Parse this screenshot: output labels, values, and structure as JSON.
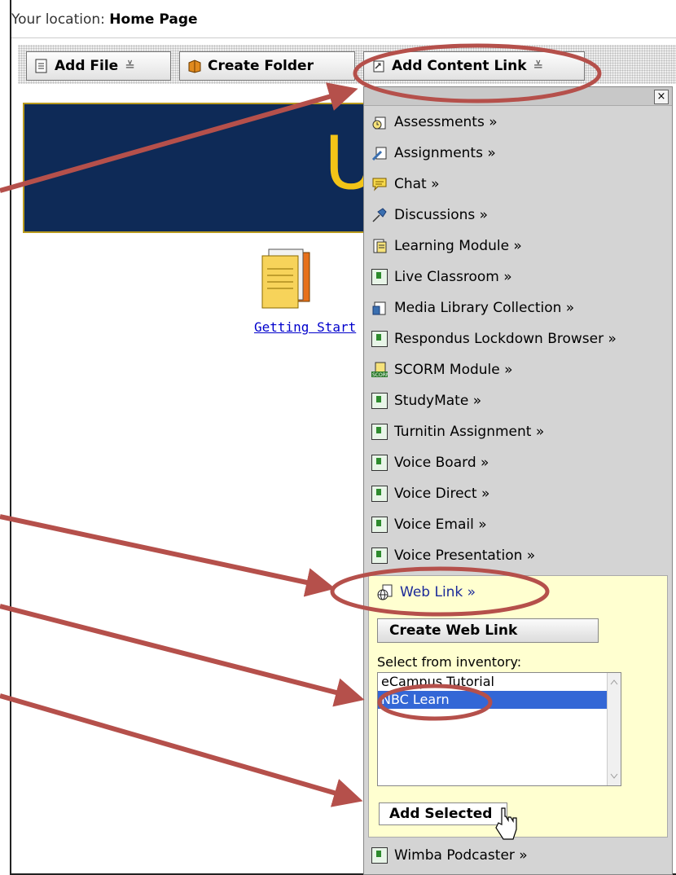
{
  "location": {
    "label": "Your location:",
    "value": "Home Page"
  },
  "toolbar": {
    "add_file": "Add File",
    "create_folder": "Create Folder",
    "add_content_link": "Add Content Link"
  },
  "banner": {
    "text": "U"
  },
  "content": {
    "link_text": "Getting Start"
  },
  "menu": {
    "close": "×",
    "items": [
      "Assessments »",
      "Assignments »",
      "Chat »",
      "Discussions »",
      "Learning Module »",
      "Live Classroom »",
      "Media Library Collection »",
      "Respondus Lockdown Browser »",
      "SCORM Module »",
      "StudyMate »",
      "Turnitin Assignment »",
      "Voice Board »",
      "Voice Direct »",
      "Voice Email »",
      "Voice Presentation »"
    ],
    "web_link": {
      "label": "Web Link »",
      "create_button": "Create Web Link",
      "inventory_label": "Select from inventory:",
      "options": [
        "eCampus Tutorial",
        "NBC Learn"
      ],
      "selected": "NBC Learn",
      "add_button": "Add Selected"
    },
    "last_item": "Wimba Podcaster »"
  },
  "colors": {
    "annotation": "#b5504b",
    "banner_bg": "#0e2a57",
    "banner_text": "#f3c417",
    "selection": "#3367d6"
  }
}
